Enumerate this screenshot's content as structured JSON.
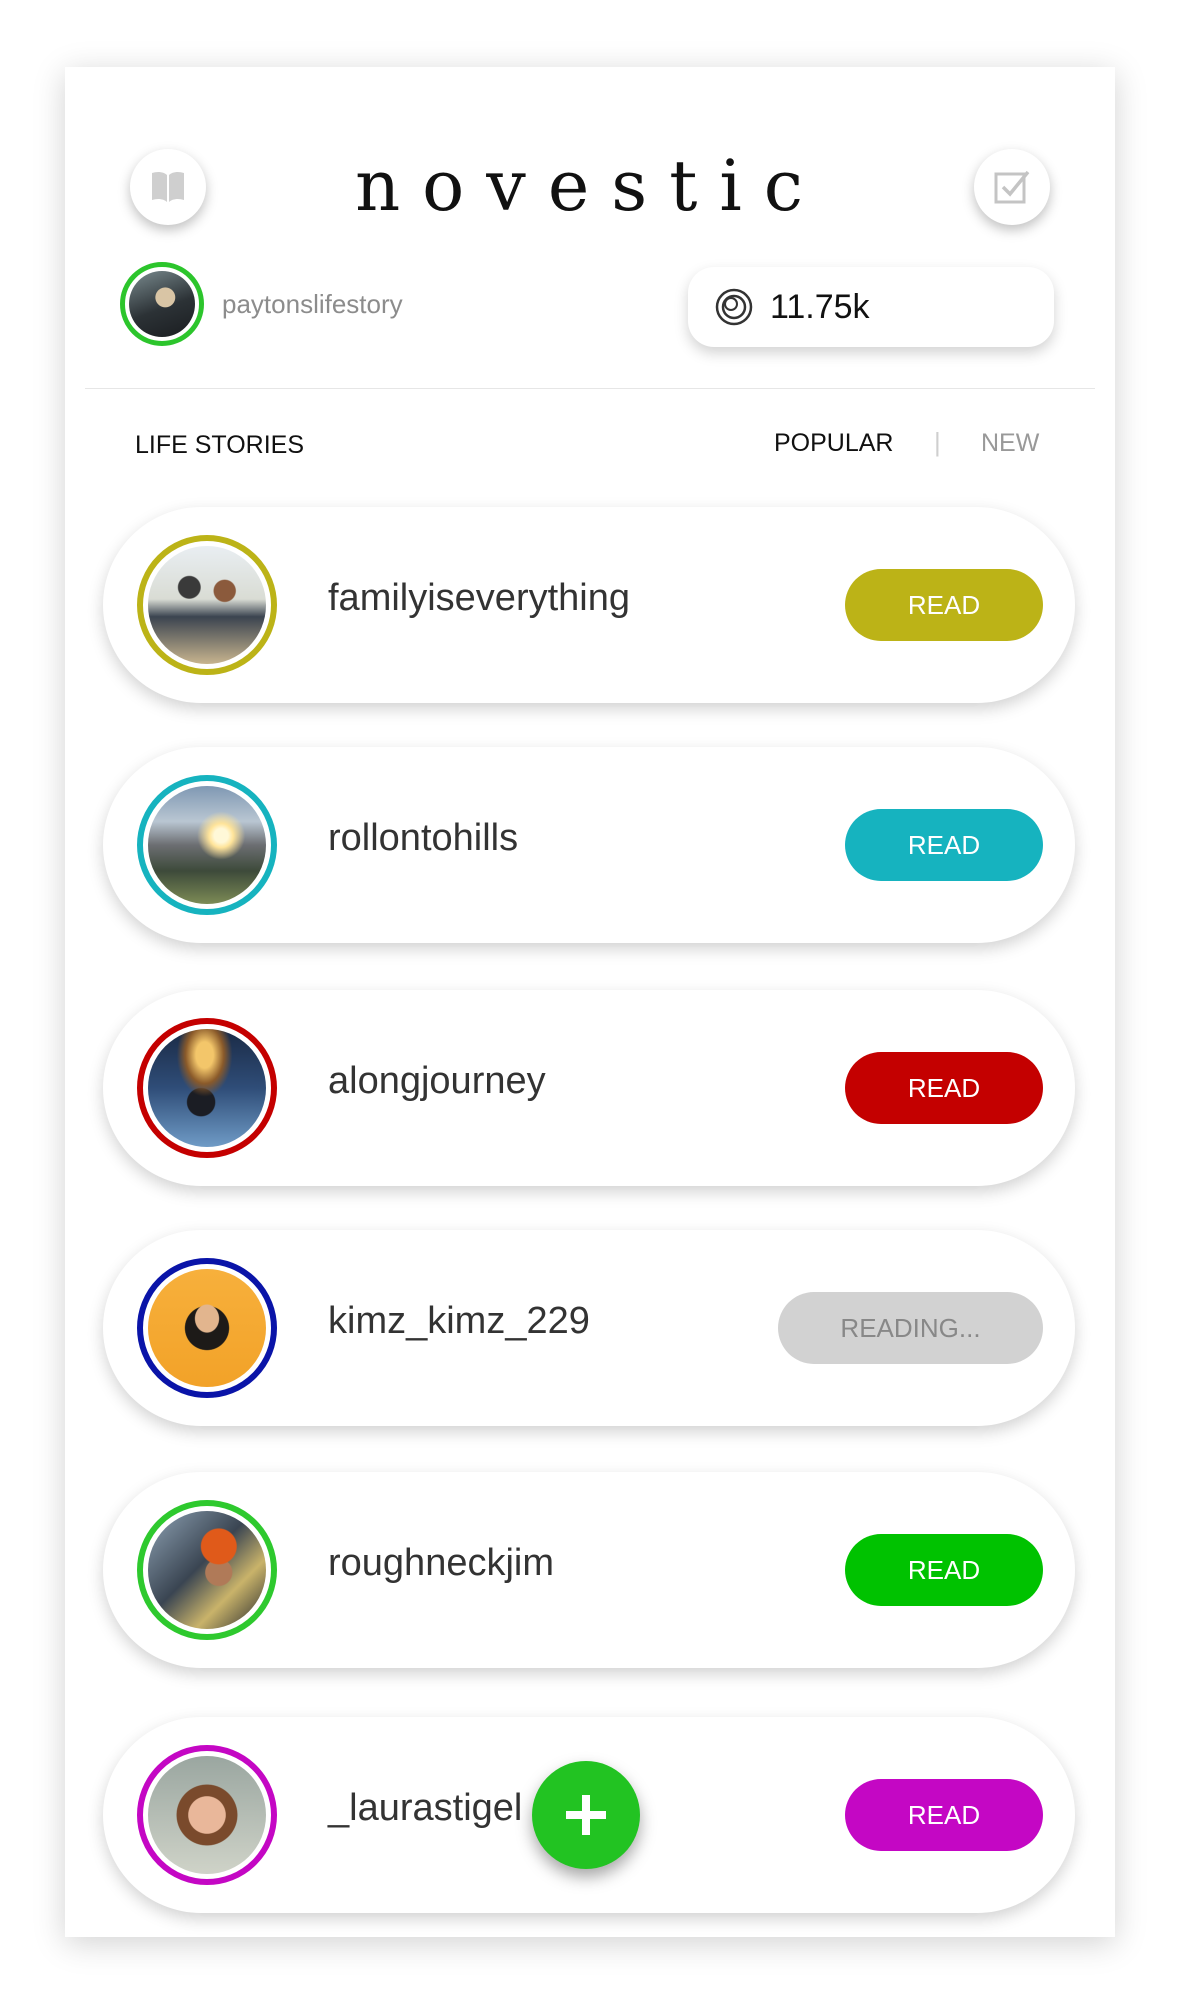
{
  "app": {
    "logo": "novestic"
  },
  "header": {
    "left_icon": "book-icon",
    "right_icon": "edit-checkbox-icon"
  },
  "profile": {
    "username": "paytonslifestory",
    "coins_icon": "coin-icon",
    "coins": "11.75k"
  },
  "section": {
    "title": "LIFE STORIES",
    "filter_popular": "POPULAR",
    "filter_separator": "|",
    "filter_new": "NEW"
  },
  "stories": [
    {
      "username": "familyiseverything",
      "button": "READ",
      "color": "#bcb317"
    },
    {
      "username": "rollontohills",
      "button": "READ",
      "color": "#16b3bf"
    },
    {
      "username": "alongjourney",
      "button": "READ",
      "color": "#c40000"
    },
    {
      "username": "kimz_kimz_229",
      "button": "READING...",
      "color": "#0a14a8",
      "button_color": "#d2d2d2"
    },
    {
      "username": "roughneckjim",
      "button": "READ",
      "color": "#00c200",
      "ring": "#2ec92e"
    },
    {
      "username": "_laurastigel",
      "button": "READ",
      "color": "#c407c4"
    }
  ],
  "fab": {
    "icon": "plus-icon",
    "color": "#22c322"
  }
}
